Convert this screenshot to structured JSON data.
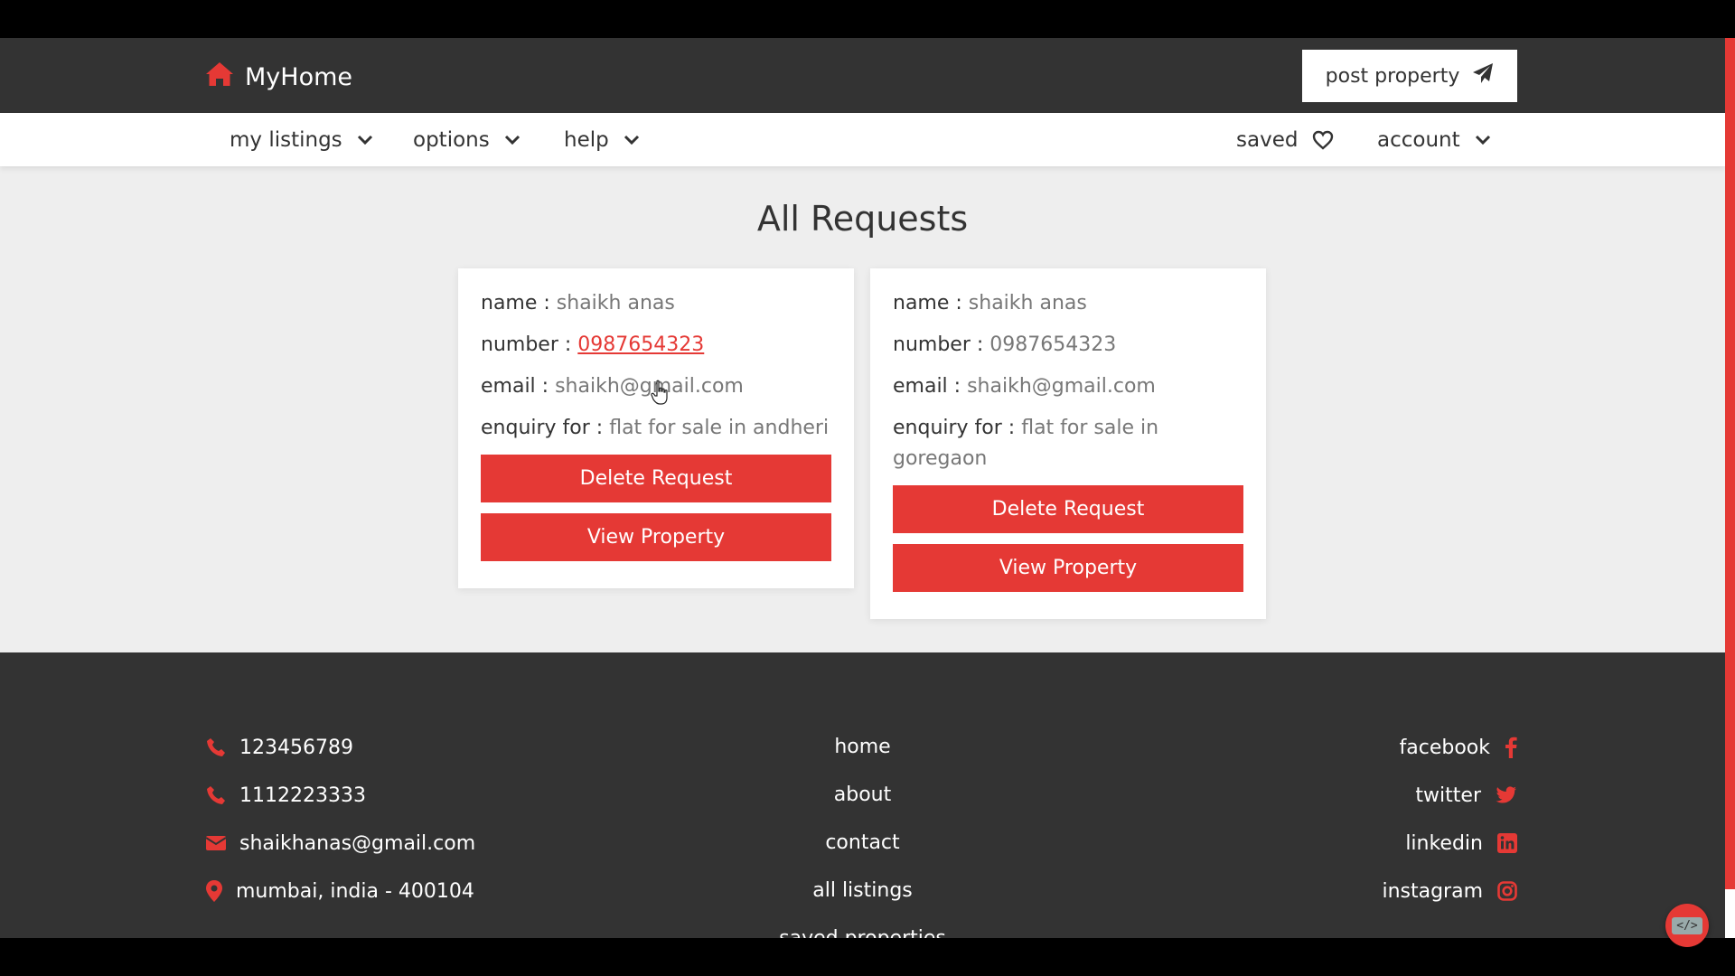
{
  "header": {
    "brand": "MyHome",
    "post_label": "post property"
  },
  "nav": {
    "left": [
      {
        "label": "my listings"
      },
      {
        "label": "options"
      },
      {
        "label": "help"
      }
    ],
    "saved_label": "saved",
    "account_label": "account"
  },
  "main": {
    "title": "All Requests",
    "requests": [
      {
        "name_label": "name :",
        "name": "shaikh anas",
        "number_label": "number :",
        "number": "0987654323",
        "email_label": "email :",
        "email": "shaikh@gmail.com",
        "enquiry_label": "enquiry for :",
        "enquiry": "flat for sale in andheri",
        "delete_label": "Delete Request",
        "view_label": "View Property"
      },
      {
        "name_label": "name :",
        "name": "shaikh anas",
        "number_label": "number :",
        "number": "0987654323",
        "email_label": "email :",
        "email": "shaikh@gmail.com",
        "enquiry_label": "enquiry for :",
        "enquiry": "flat for sale in goregaon",
        "delete_label": "Delete Request",
        "view_label": "View Property"
      }
    ]
  },
  "footer": {
    "contacts": [
      {
        "icon": "phone-icon",
        "text": "123456789"
      },
      {
        "icon": "phone-icon",
        "text": "1112223333"
      },
      {
        "icon": "envelope-icon",
        "text": "shaikhanas@gmail.com"
      },
      {
        "icon": "map-marker-icon",
        "text": "mumbai, india - 400104"
      }
    ],
    "links": [
      "home",
      "about",
      "contact",
      "all listings",
      "saved properties"
    ],
    "social": [
      {
        "label": "facebook",
        "icon": "facebook-icon"
      },
      {
        "label": "twitter",
        "icon": "twitter-icon"
      },
      {
        "label": "linkedin",
        "icon": "linkedin-icon"
      },
      {
        "label": "instagram",
        "icon": "instagram-icon"
      }
    ]
  },
  "colors": {
    "accent": "#e53935",
    "dark": "#333333",
    "page_bg": "#eeeeee"
  }
}
